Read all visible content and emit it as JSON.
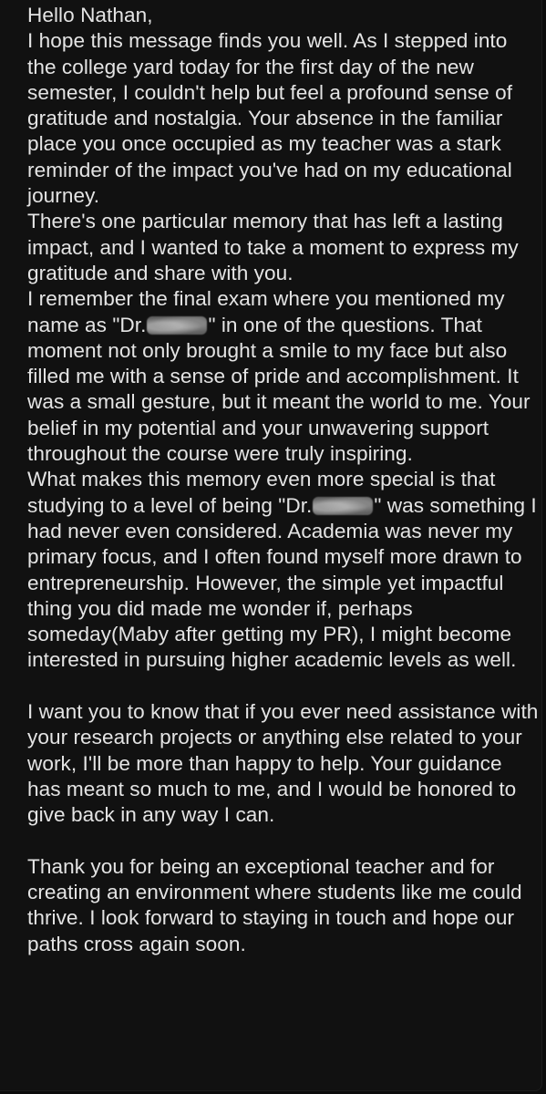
{
  "message": {
    "greeting": "Hello Nathan,",
    "p1": "I hope this message finds you well. As I stepped into the college yard today for the first day of the new semester, I couldn't help but feel a profound sense of gratitude and nostalgia. Your absence in the familiar place you once occupied as my teacher was a stark reminder of the impact you've had on my educational journey.",
    "p2": "There's one particular memory that has left a lasting impact, and I wanted to take a moment to express my gratitude and share with you.",
    "p3_before": "I remember the final exam where you mentioned my name as \"Dr.",
    "p3_after": "\" in one of the questions. That moment not only brought a smile to my face but also filled me with a sense of pride and accomplishment. It was a small gesture, but it meant the world to me. Your belief in my potential and your unwavering support throughout the course were truly inspiring.",
    "p4_before": "What makes this memory even more special is that studying to a level of being \"Dr.",
    "p4_after": "\" was something I had never even considered. Academia was never my primary focus, and I often found myself more drawn to entrepreneurship. However, the simple yet impactful thing you did made me wonder if, perhaps someday(Maby after getting my PR), I might become interested in pursuing higher academic levels as well.",
    "p5": "I want you to know that if you ever need assistance with your research projects or anything else related to your work, I'll be more than happy to help. Your guidance has meant so much to me, and I would be honored to give back in any way I can.",
    "p6": "Thank you for being an exceptional teacher and for creating an environment where students like me could thrive. I look forward to staying in touch and hope our paths cross again soon."
  },
  "colors": {
    "background": "#0c0c0c",
    "bubble": "#111111",
    "text": "#e4e4e4",
    "redaction": "#5f5f5f"
  }
}
